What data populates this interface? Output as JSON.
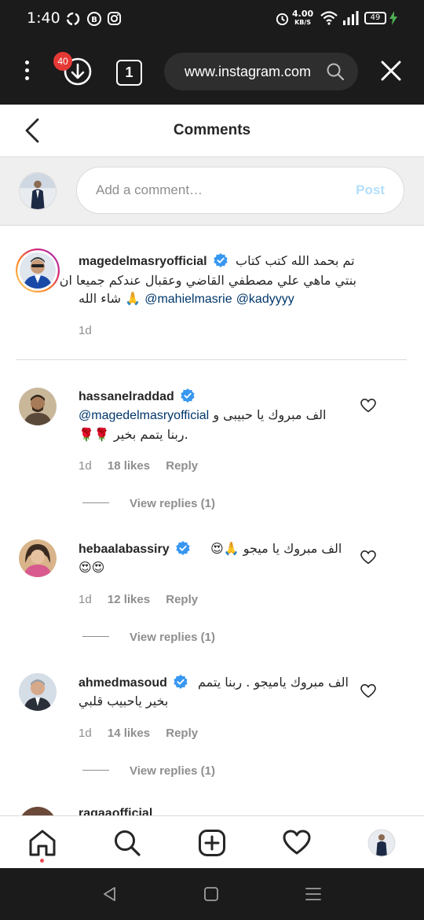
{
  "status_bar": {
    "time": "1:40",
    "net_speed_value": "4.00",
    "net_speed_unit": "KB/S",
    "battery": "49"
  },
  "browser": {
    "download_badge": "40",
    "tab_count": "1",
    "url": "www.instagram.com"
  },
  "header": {
    "title": "Comments"
  },
  "composer": {
    "placeholder": "Add a comment…",
    "post_label": "Post"
  },
  "caption": {
    "username": "magedelmasryofficial",
    "line1": "تم بحمد الله كتب كتاب",
    "line2": "بنتي ماهي علي مصطفي القاضي وعقبال عندكم جميعا ان",
    "line3_text": "شاء الله",
    "line3_emoji": "🙏",
    "mention1": "@mahielmasrie",
    "mention2": "@kadyyyy",
    "time": "1d"
  },
  "comments": [
    {
      "username": "hassanelraddad",
      "line1_text": "الف مبروك يا حبيبى و",
      "line1_mention": "@magedelmasryofficial",
      "line2": ".ربنا يتمم بخير 🌹🌹",
      "time": "1d",
      "likes": "18 likes",
      "reply": "Reply",
      "view_replies": "View replies (1)"
    },
    {
      "username": "hebaalabassiry",
      "line1": "الف مبروك يا ميجو 🙏😍",
      "line2": "😍😍",
      "time": "1d",
      "likes": "12 likes",
      "reply": "Reply",
      "view_replies": "View replies (1)"
    },
    {
      "username": "ahmedmasoud",
      "line1": "الف مبروك ياميجو . ربنا يتمم",
      "line2": "بخير ياحبيب قلبي",
      "time": "1d",
      "likes": "14 likes",
      "reply": "Reply",
      "view_replies": "View replies (1)"
    }
  ],
  "partial_comment": {
    "username": "ragaaofficial"
  },
  "colors": {
    "accent": "#0095f6",
    "post_disabled": "#b2dffc",
    "verified": "#3897f0",
    "mention": "#00376b",
    "notification_dot": "#ed4956",
    "badge": "#e53935"
  },
  "icons": {
    "status": [
      "refresh-icon",
      "vpn-icon",
      "instagram-icon",
      "alarm-icon",
      "wifi-icon",
      "signal-icon",
      "battery-icon",
      "charging-icon"
    ],
    "browser": [
      "more-vert-icon",
      "download-icon",
      "tabs-icon",
      "search-icon",
      "close-icon"
    ],
    "bottom_nav": [
      "home-icon",
      "search-icon",
      "add-post-icon",
      "heart-icon",
      "profile-avatar"
    ],
    "android_nav": [
      "back-triangle-icon",
      "home-square-icon",
      "recents-menu-icon"
    ]
  }
}
